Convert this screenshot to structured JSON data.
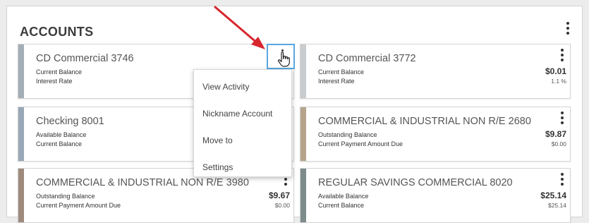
{
  "header": {
    "title": "ACCOUNTS"
  },
  "accounts": [
    {
      "name": "CD Commercial 3746",
      "label1": "Current Balance",
      "value1": "",
      "label2": "Interest Rate",
      "value2": "",
      "accent": "#a4aeb6"
    },
    {
      "name": "CD Commercial 3772",
      "label1": "Current Balance",
      "value1": "$0.01",
      "label2": "Interest Rate",
      "value2": "1.1 %",
      "accent": "#c9ccce"
    },
    {
      "name": "Checking 8001",
      "label1": "Available Balance",
      "value1": "",
      "label2": "Current Balance",
      "value2": "",
      "accent": "#98a8b6"
    },
    {
      "name": "COMMERCIAL & INDUSTRIAL NON R/E 2680",
      "label1": "Outstanding Balance",
      "value1": "$9.87",
      "label2": "Current Payment Amount Due",
      "value2": "$0.00",
      "accent": "#b5a48c"
    },
    {
      "name": "COMMERCIAL & INDUSTRIAL NON R/E 3980",
      "label1": "Outstanding Balance",
      "value1": "$9.67",
      "label2": "Current Payment Amount Due",
      "value2": "$0.00",
      "accent": "#9e8a7c"
    },
    {
      "name": "REGULAR SAVINGS COMMERCIAL 8020",
      "label1": "Available Balance",
      "value1": "$25.14",
      "label2": "Current Balance",
      "value2": "$25.14",
      "accent": "#7d8c8a"
    }
  ],
  "menu": {
    "items": [
      "View Activity",
      "Nickname Account",
      "Move to",
      "Settings"
    ]
  },
  "icons": {
    "panel_menu": "kebab-icon",
    "card_menu": "kebab-icon",
    "cursor": "hand-pointer-icon",
    "annotation": "red-arrow-icon"
  },
  "colors": {
    "highlight": "#5aa7e0",
    "arrow": "#d7262e"
  }
}
